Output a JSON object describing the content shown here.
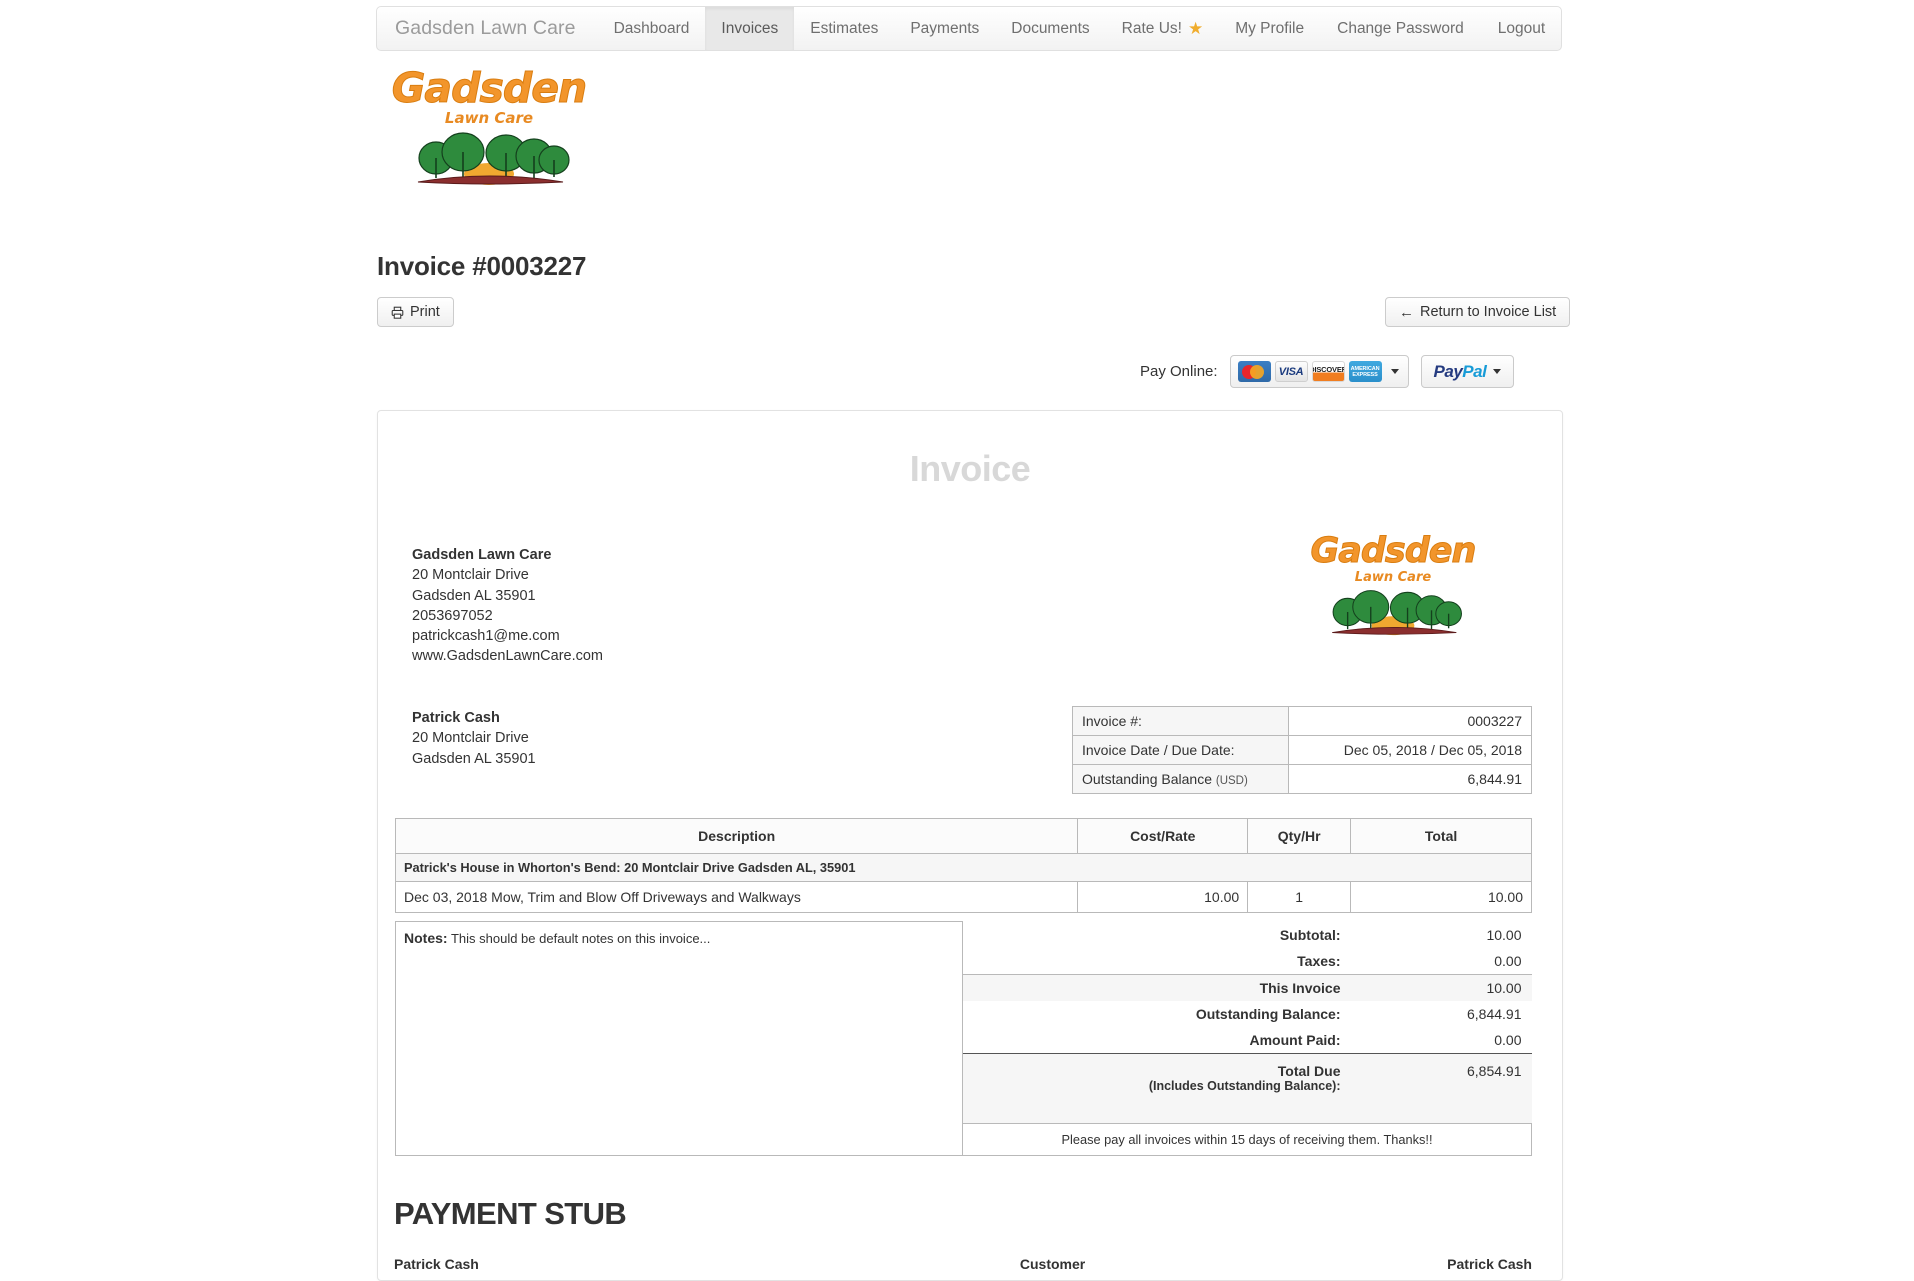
{
  "navbar": {
    "brand": "Gadsden Lawn Care",
    "left_items": [
      {
        "label": "Dashboard",
        "active": false
      },
      {
        "label": "Invoices",
        "active": true
      },
      {
        "label": "Estimates",
        "active": false
      },
      {
        "label": "Payments",
        "active": false
      },
      {
        "label": "Documents",
        "active": false
      },
      {
        "label": "Rate Us!",
        "active": false,
        "icon": "star-icon"
      },
      {
        "label": "My Profile",
        "active": false
      }
    ],
    "right_items": [
      {
        "label": "Change Password"
      },
      {
        "label": "Logout"
      }
    ]
  },
  "logo": {
    "word": "Gadsden",
    "sub": "Lawn Care",
    "color": "#F2952B",
    "tree_color": "#2e8b3d",
    "sun_color": "#f0a830",
    "ground_color": "#8b2e2e"
  },
  "header": {
    "page_title": "Invoice #0003227",
    "print_button": "Print",
    "print_icon": "printer-icon",
    "return_button": "Return to Invoice List",
    "return_icon": "arrow-left-icon",
    "pay_online_label": "Pay Online:",
    "cards": [
      "mastercard-icon",
      "visa-icon",
      "discover-icon",
      "amex-icon"
    ],
    "card_names": {
      "visa": "VISA",
      "discover": "DISCOVER",
      "amex_line1": "AMERICAN",
      "amex_line2": "EXPRESS"
    },
    "paypal_label_a": "Pay",
    "paypal_label_b": "Pal",
    "dropdown_icon": "chevron-down-icon"
  },
  "invoice": {
    "watermark": "Invoice",
    "company": {
      "name": "Gadsden Lawn Care",
      "address1": "20 Montclair Drive",
      "address2": "Gadsden AL 35901",
      "phone": "2053697052",
      "email": "patrickcash1@me.com",
      "website": "www.GadsdenLawnCare.com"
    },
    "customer": {
      "name": "Patrick Cash",
      "address1": "20 Montclair Drive",
      "address2": "Gadsden AL 35901"
    },
    "info": [
      {
        "key": "Invoice #:",
        "value": "0003227"
      },
      {
        "key": "Invoice Date / Due Date:",
        "value": "Dec 05, 2018 / Dec 05, 2018"
      },
      {
        "key": "Outstanding Balance",
        "key_suffix": "(USD)",
        "value": "6,844.91"
      }
    ],
    "columns": [
      "Description",
      "Cost/Rate",
      "Qty/Hr",
      "Total"
    ],
    "group_row": "Patrick's House in Whorton's Bend: 20 Montclair Drive Gadsden AL, 35901",
    "line_items": [
      {
        "description": "Dec 03, 2018 Mow, Trim and Blow Off Driveways and Walkways",
        "rate": "10.00",
        "qty": "1",
        "total": "10.00"
      }
    ],
    "notes_label": "Notes:",
    "notes_text": "This should be default notes on this invoice...",
    "totals": [
      {
        "label": "Subtotal:",
        "value": "10.00",
        "highlight": false
      },
      {
        "label": "Taxes:",
        "value": "0.00",
        "highlight": false
      },
      {
        "label": "This Invoice",
        "value": "10.00",
        "highlight": true
      },
      {
        "label": "Outstanding Balance:",
        "value": "6,844.91",
        "highlight": false
      },
      {
        "label": "Amount Paid:",
        "value": "0.00",
        "highlight": false
      }
    ],
    "total_due_label": "Total Due",
    "total_due_sub": "(Includes Outstanding Balance):",
    "total_due_value": "6,854.91",
    "footnote": "Please pay all invoices within 15 days of receiving them. Thanks!!"
  },
  "stub": {
    "title": "PAYMENT STUB",
    "name": "Patrick Cash",
    "customer_label": "Customer",
    "customer_value": "Patrick Cash"
  }
}
